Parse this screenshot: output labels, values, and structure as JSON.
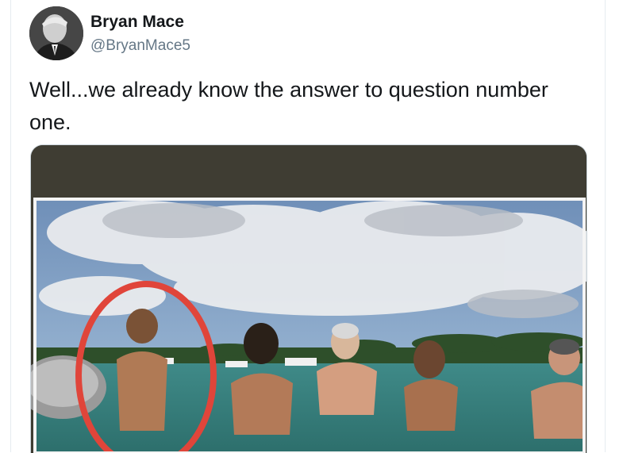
{
  "tweet": {
    "author_name": "Bryan Mace",
    "author_handle": "@BryanMace5",
    "text": "Well...we already know the answer to question number one."
  },
  "media": {
    "description_icon": "photo",
    "annotation_color": "#e0453a"
  }
}
